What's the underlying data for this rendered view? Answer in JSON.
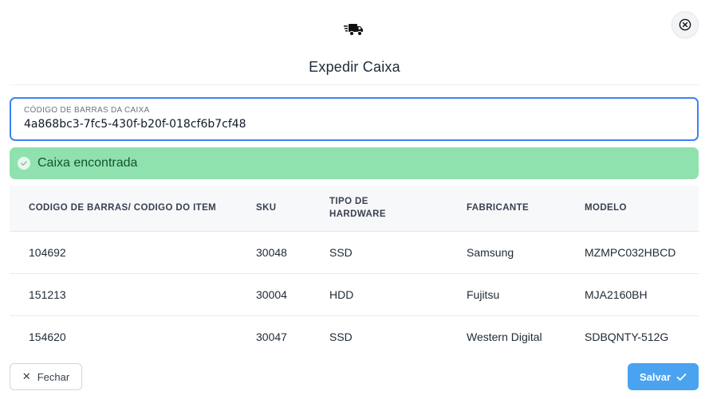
{
  "header": {
    "icon": "truck-fast-icon",
    "close_icon": "close-circle-icon",
    "title": "Expedir Caixa"
  },
  "barcode_field": {
    "label": "CÓDIGO DE BARRAS DA CAIXA",
    "value": "4a868bc3-7fc5-430f-b20f-018cf6b7cf48"
  },
  "alert": {
    "icon": "check-circle-icon",
    "text": "Caixa encontrada",
    "color": "#8fe2ae"
  },
  "table": {
    "headers": [
      "CODIGO DE BARRAS/ CODIGO DO ITEM",
      "SKU",
      "TIPO DE HARDWARE",
      "FABRICANTE",
      "MODELO"
    ],
    "rows": [
      [
        "104692",
        "30048",
        "SSD",
        "Samsung",
        "MZMPC032HBCD"
      ],
      [
        "151213",
        "30004",
        "HDD",
        "Fujitsu",
        "MJA2160BH"
      ],
      [
        "154620",
        "30047",
        "SSD",
        "Western Digital",
        "SDBQNTY-512G"
      ]
    ]
  },
  "footer": {
    "close_label": "Fechar",
    "close_icon": "x-icon",
    "save_label": "Salvar",
    "save_icon": "check-icon",
    "accent": "#4aa3f0"
  }
}
